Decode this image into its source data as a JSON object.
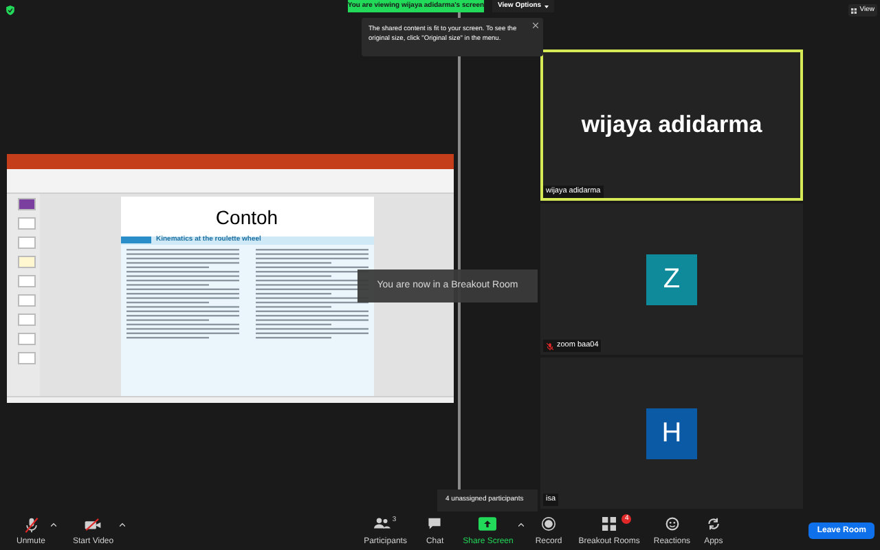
{
  "top_bar": {
    "share_banner": "You are viewing wijaya adidarma's screen",
    "view_options": "View Options",
    "view_button": "View"
  },
  "tooltip": {
    "text": "The shared content is fit to your screen. To see the original size, click \"Original size\" in the menu."
  },
  "shared_screen": {
    "slide_title": "Contoh",
    "example_heading": "Kinematics at the roulette wheel"
  },
  "notice": "You are now in a Breakout Room",
  "tiles": [
    {
      "kind": "name",
      "name": "wijaya adidarma",
      "label": "wijaya adidarma",
      "active_speaker": true,
      "muted": false
    },
    {
      "kind": "initial",
      "initial": "Z",
      "color": "#0e8a9a",
      "label": "zoom baa04",
      "active_speaker": false,
      "muted": true
    },
    {
      "kind": "initial",
      "initial": "H",
      "color": "#0b5aa5",
      "label": "isa",
      "active_speaker": false,
      "muted": false
    }
  ],
  "popup": "4 unassigned participants",
  "toolbar": [
    {
      "kind": "mic",
      "label": "Unmute",
      "off": true,
      "caret": true
    },
    {
      "kind": "video",
      "label": "Start Video",
      "off": true,
      "caret": true
    },
    {
      "kind": "participants",
      "label": "Participants",
      "count": "3",
      "caret": false
    },
    {
      "kind": "chat",
      "label": "Chat",
      "caret": false
    },
    {
      "kind": "share",
      "label": "Share Screen",
      "caret": true
    },
    {
      "kind": "record",
      "label": "Record",
      "caret": false
    },
    {
      "kind": "breakout",
      "label": "Breakout Rooms",
      "badge": "4",
      "caret": false
    },
    {
      "kind": "reactions",
      "label": "Reactions",
      "caret": false
    },
    {
      "kind": "apps",
      "label": "Apps",
      "caret": false
    }
  ],
  "leave_button": "Leave Room"
}
